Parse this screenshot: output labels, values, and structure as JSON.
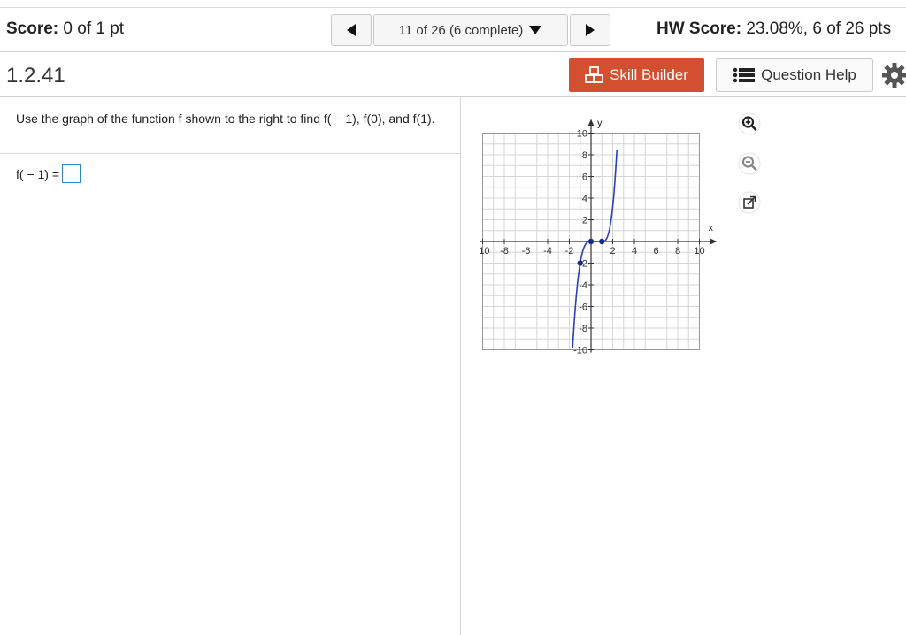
{
  "header": {
    "score_label": "Score:",
    "score_value": "0 of 1 pt",
    "nav_prev_icon": "triangle-left-icon",
    "nav_position": "11 of 26 (6 complete)",
    "nav_dropdown_icon": "triangle-down-icon",
    "nav_next_icon": "triangle-right-icon",
    "hw_label": "HW Score:",
    "hw_value": "23.08%, 6 of 26 pts"
  },
  "question_bar": {
    "number": "1.2.41",
    "skill_builder_label": "Skill Builder",
    "skill_builder_icon": "blocks-icon",
    "question_help_label": "Question Help",
    "question_help_icon": "list-icon",
    "settings_icon": "gear-icon",
    "colors": {
      "skill_builder_bg": "#d2502f"
    }
  },
  "problem": {
    "text": "Use the graph of the function f shown to the right to find f( − 1), f(0), and f(1).",
    "answer_label": "f( − 1) ="
  },
  "graph": {
    "x_axis_label": "x",
    "y_axis_label": "y",
    "x_tick_labels": [
      "-10",
      "-8",
      "-6",
      "-4",
      "-2",
      "2",
      "4",
      "6",
      "8",
      "10"
    ],
    "y_tick_labels": [
      "10",
      "8",
      "6",
      "4",
      "2",
      "-2",
      "-4",
      "-6",
      "-8",
      "-10"
    ],
    "range": {
      "x": [
        -10,
        10
      ],
      "y": [
        -10,
        10
      ]
    },
    "curve_color": "#2b3fbf",
    "points": [
      [
        -1,
        -2
      ],
      [
        0,
        0
      ],
      [
        1,
        0
      ]
    ],
    "tools": [
      "zoom-in-icon",
      "zoom-out-icon",
      "popout-icon"
    ]
  }
}
